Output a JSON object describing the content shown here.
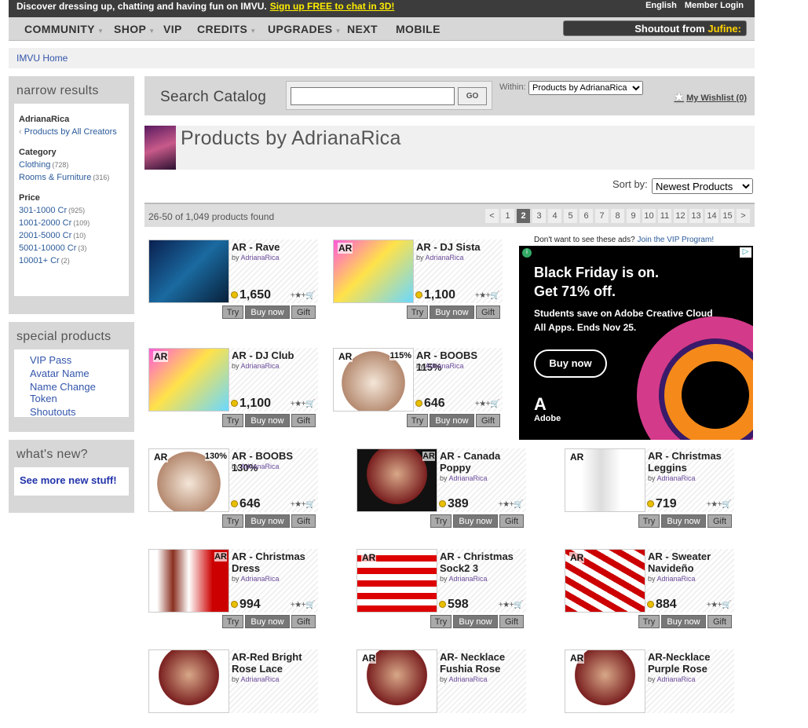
{
  "topbar": {
    "promo": "Discover dressing up, chatting and having fun on IMVU.",
    "signup": "Sign up FREE to chat in 3D!",
    "language": "English",
    "login": "Member Login"
  },
  "nav": {
    "items": [
      "COMMUNITY",
      "SHOP",
      "VIP",
      "CREDITS",
      "UPGRADES",
      "NEXT",
      "MOBILE"
    ],
    "shoutout_prefix": "Shoutout from",
    "shoutout_name": "Jufine:"
  },
  "breadcrumb": "IMVU Home",
  "sidebar": {
    "narrow_title": "narrow results",
    "creator": "AdrianaRica",
    "all_creators": "Products by All Creators",
    "category_title": "Category",
    "categories": [
      {
        "label": "Clothing",
        "count": "(728)"
      },
      {
        "label": "Rooms & Furniture",
        "count": "(316)"
      }
    ],
    "price_title": "Price",
    "prices": [
      {
        "label": "301-1000 Cr",
        "count": "(925)"
      },
      {
        "label": "1001-2000 Cr",
        "count": "(109)"
      },
      {
        "label": "2001-5000 Cr",
        "count": "(10)"
      },
      {
        "label": "5001-10000 Cr",
        "count": "(3)"
      },
      {
        "label": "10001+ Cr",
        "count": "(2)"
      }
    ],
    "special_title": "special products",
    "special": [
      "VIP Pass",
      "Avatar Name",
      "Name Change Token",
      "Shoutouts"
    ],
    "new_title": "what's new?",
    "new_link": "See more new stuff!"
  },
  "search": {
    "label": "Search Catalog",
    "go": "GO",
    "within_label": "Within:",
    "within_value": "Products by AdrianaRica",
    "wishlist": "My Wishlist (0)"
  },
  "page_title": "Products by AdrianaRica",
  "sort": {
    "label": "Sort by:",
    "value": "Newest Products"
  },
  "results": {
    "found": "26-50 of 1,049 products found",
    "pages": [
      "<",
      "1",
      "2",
      "3",
      "4",
      "5",
      "6",
      "7",
      "8",
      "9",
      "10",
      "11",
      "12",
      "13",
      "14",
      "15",
      ">"
    ],
    "current": "2"
  },
  "ad": {
    "note": "Don't want to see these ads?",
    "vip": "Join the VIP Program!",
    "headline1": "Black Friday is on.",
    "headline2": "Get 71% off.",
    "sub1": "Students save on Adobe Creative Cloud",
    "sub2": "All Apps. Ends Nov 25.",
    "cta": "Buy now",
    "brand": "Adobe"
  },
  "labels": {
    "by": "by",
    "try": "Try",
    "buy": "Buy now",
    "gift": "Gift",
    "creator": "AdrianaRica",
    "tools": "+★+🛒"
  },
  "products": [
    {
      "name": "AR - Rave",
      "price": "1,650",
      "tag": "",
      "tag2": ""
    },
    {
      "name": "AR - DJ Sista",
      "price": "1,100",
      "tag": "AR",
      "tag2": ""
    },
    {
      "name": "AR - DJ Club",
      "price": "1,100",
      "tag": "AR",
      "tag2": ""
    },
    {
      "name": "AR - BOOBS 115%",
      "price": "646",
      "tag": "AR",
      "tag2": "115%"
    },
    {
      "name": "AR - BOOBS 130%",
      "price": "646",
      "tag": "AR",
      "tag2": "130%"
    },
    {
      "name": "AR - Canada Poppy",
      "price": "389",
      "tag": "",
      "tag2": "AR"
    },
    {
      "name": "AR - Christmas Leggins",
      "price": "719",
      "tag": "AR",
      "tag2": ""
    },
    {
      "name": "AR - Christmas Dress",
      "price": "994",
      "tag": "",
      "tag2": "AR"
    },
    {
      "name": "AR - Christmas Sock2 3",
      "price": "598",
      "tag": "AR",
      "tag2": ""
    },
    {
      "name": "AR - Sweater Navideño",
      "price": "884",
      "tag": "AR",
      "tag2": ""
    },
    {
      "name": "AR-Red Bright Rose Lace",
      "price": "",
      "tag": "",
      "tag2": ""
    },
    {
      "name": "AR- Necklace Fushia Rose",
      "price": "",
      "tag": "AR",
      "tag2": ""
    },
    {
      "name": "AR-Necklace Purple Rose",
      "price": "",
      "tag": "AR",
      "tag2": ""
    }
  ]
}
